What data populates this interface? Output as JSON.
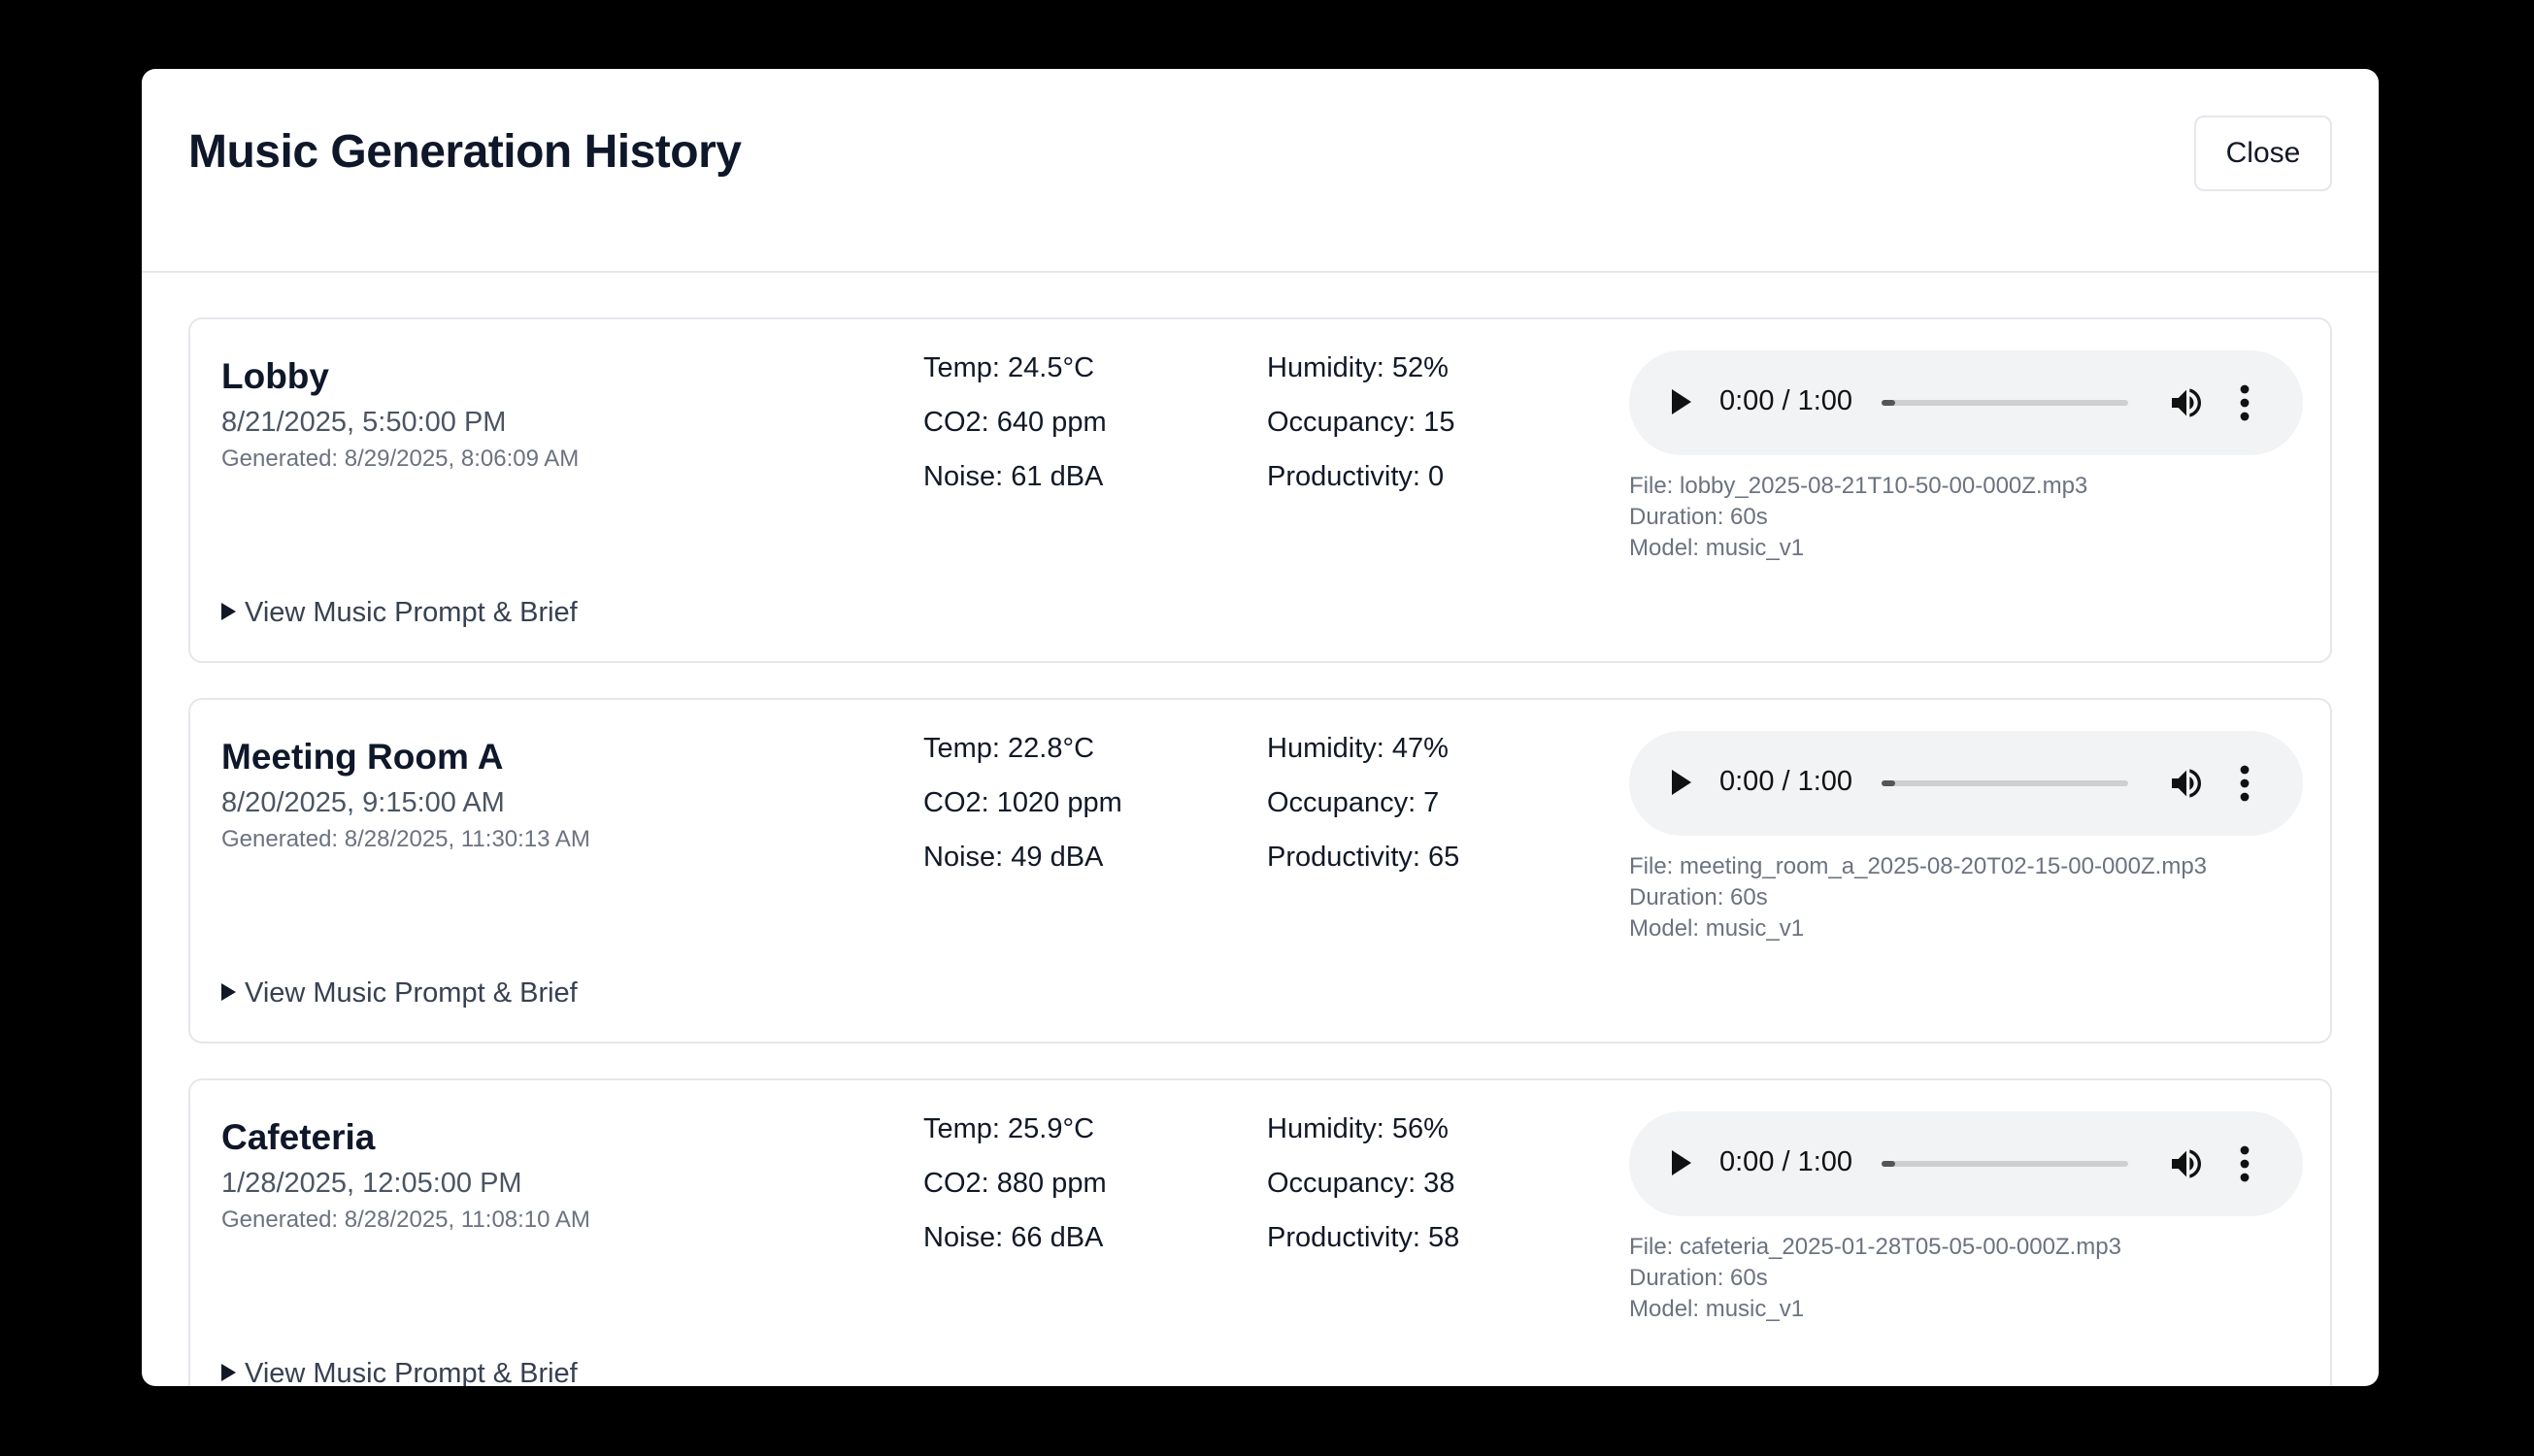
{
  "modal": {
    "title": "Music Generation History",
    "close_label": "Close"
  },
  "entries": [
    {
      "location": "Lobby",
      "datetime": "8/21/2025, 5:50:00 PM",
      "generated": "Generated: 8/29/2025, 8:06:09 AM",
      "temp": "Temp: 24.5°C",
      "humidity": "Humidity: 52%",
      "co2": "CO2: 640 ppm",
      "occupancy": "Occupancy: 15",
      "noise": "Noise: 61 dBA",
      "productivity": "Productivity: 0",
      "audio": {
        "time": "0:00 / 1:00",
        "progress_fraction": 0.0
      },
      "file": "File: lobby_2025-08-21T10-50-00-000Z.mp3",
      "duration": "Duration: 60s",
      "model": "Model: music_v1",
      "prompt_toggle": "View Music Prompt & Brief"
    },
    {
      "location": "Meeting Room A",
      "datetime": "8/20/2025, 9:15:00 AM",
      "generated": "Generated: 8/28/2025, 11:30:13 AM",
      "temp": "Temp: 22.8°C",
      "humidity": "Humidity: 47%",
      "co2": "CO2: 1020 ppm",
      "occupancy": "Occupancy: 7",
      "noise": "Noise: 49 dBA",
      "productivity": "Productivity: 65",
      "audio": {
        "time": "0:00 / 1:00",
        "progress_fraction": 0.0
      },
      "file": "File: meeting_room_a_2025-08-20T02-15-00-000Z.mp3",
      "duration": "Duration: 60s",
      "model": "Model: music_v1",
      "prompt_toggle": "View Music Prompt & Brief"
    },
    {
      "location": "Cafeteria",
      "datetime": "1/28/2025, 12:05:00 PM",
      "generated": "Generated: 8/28/2025, 11:08:10 AM",
      "temp": "Temp: 25.9°C",
      "humidity": "Humidity: 56%",
      "co2": "CO2: 880 ppm",
      "occupancy": "Occupancy: 38",
      "noise": "Noise: 66 dBA",
      "productivity": "Productivity: 58",
      "audio": {
        "time": "0:00 / 1:00",
        "progress_fraction": 0.0
      },
      "file": "File: cafeteria_2025-01-28T05-05-00-000Z.mp3",
      "duration": "Duration: 60s",
      "model": "Model: music_v1",
      "prompt_toggle": "View Music Prompt & Brief"
    }
  ],
  "icons": {
    "play": "play-icon",
    "volume": "volume-icon",
    "more": "more-vertical-icon",
    "disclosure": "triangle-right-icon"
  },
  "colors": {
    "backdrop": "#000000",
    "surface": "#ffffff",
    "border": "#e5e7eb",
    "muted_text": "#6b7280",
    "player_bg": "#f1f3f4"
  }
}
